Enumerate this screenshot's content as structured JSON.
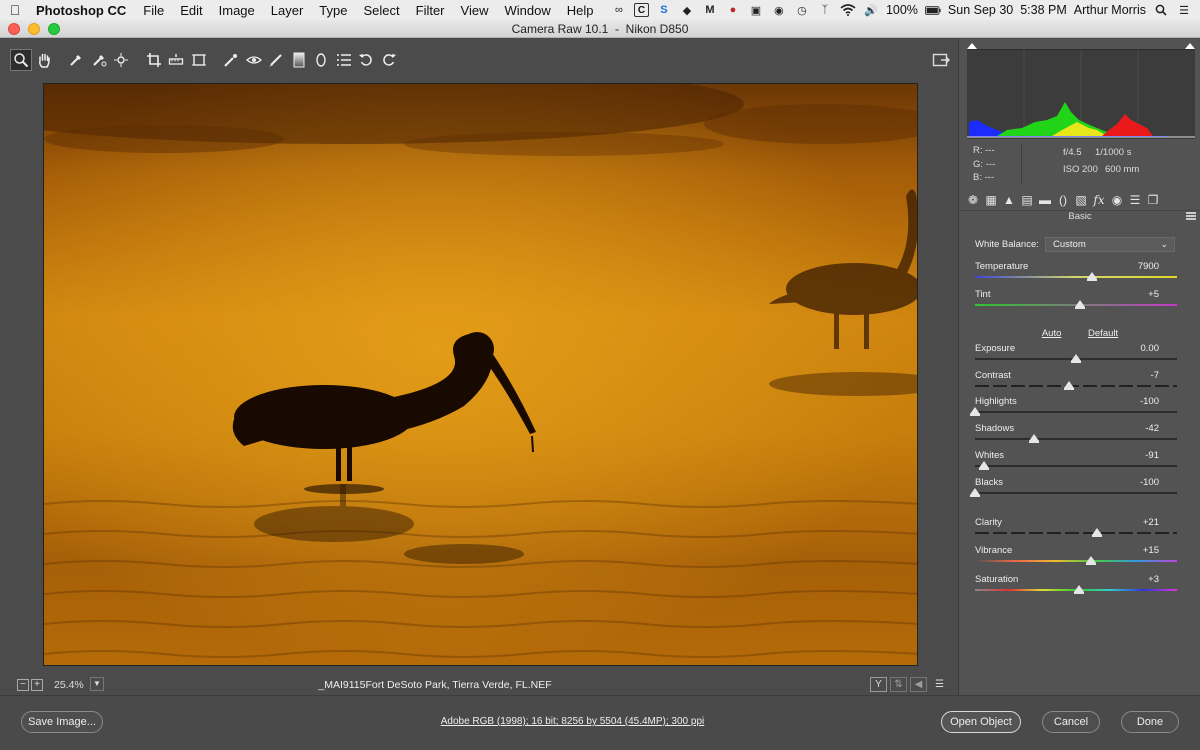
{
  "menubar": {
    "app_name": "Photoshop CC",
    "items": [
      "File",
      "Edit",
      "Image",
      "Layer",
      "Type",
      "Select",
      "Filter",
      "View",
      "Window",
      "Help"
    ],
    "battery": "100%",
    "clock": "Sun Sep 30  5:38 PM",
    "user": "Arthur Morris"
  },
  "window": {
    "title": "Camera Raw 10.1  -  Nikon D850"
  },
  "toolbar": {
    "tools": [
      "zoom-icon",
      "hand-icon",
      "white-balance-icon",
      "color-sampler-icon",
      "target-adjust-icon",
      "crop-icon",
      "straighten-icon",
      "transform-icon",
      "spot-removal-icon",
      "red-eye-icon",
      "adjustment-brush-icon",
      "graduated-filter-icon",
      "radial-filter-icon",
      "preferences-icon",
      "rotate-left-icon",
      "rotate-right-icon"
    ]
  },
  "bottombar": {
    "zoom": "25.4%",
    "filename": "_MAI9115Fort DeSoto Park, Tierra Verde, FL.NEF",
    "before_after_label": "Y"
  },
  "histogram": {
    "r_label": "R:",
    "g_label": "G:",
    "b_label": "B:",
    "r_value": "---",
    "g_value": "---",
    "b_value": "---"
  },
  "exif": {
    "aperture": "f/4.5",
    "shutter": "1/1000 s",
    "iso": "ISO 200",
    "focal": "600 mm"
  },
  "panel": {
    "title": "Basic",
    "white_balance_label": "White Balance:",
    "white_balance_value": "Custom",
    "auto_label": "Auto",
    "default_label": "Default",
    "sliders": [
      {
        "label": "Temperature",
        "value": "7900",
        "pos": 0.58,
        "track": "temp"
      },
      {
        "label": "Tint",
        "value": "+5",
        "pos": 0.52,
        "track": "tint"
      },
      {
        "label": "Exposure",
        "value": "0.00",
        "pos": 0.5,
        "track": "plain"
      },
      {
        "label": "Contrast",
        "value": "-7",
        "pos": 0.465,
        "track": "dashed"
      },
      {
        "label": "Highlights",
        "value": "-100",
        "pos": 0.0,
        "track": "plain"
      },
      {
        "label": "Shadows",
        "value": "-42",
        "pos": 0.29,
        "track": "plain"
      },
      {
        "label": "Whites",
        "value": "-91",
        "pos": 0.045,
        "track": "plain"
      },
      {
        "label": "Blacks",
        "value": "-100",
        "pos": 0.0,
        "track": "plain"
      },
      {
        "label": "Clarity",
        "value": "+21",
        "pos": 0.605,
        "track": "dashed"
      },
      {
        "label": "Vibrance",
        "value": "+15",
        "pos": 0.575,
        "track": "vibrance"
      },
      {
        "label": "Saturation",
        "value": "+3",
        "pos": 0.515,
        "track": "saturation"
      }
    ]
  },
  "footer": {
    "save_label": "Save Image...",
    "workflow": "Adobe RGB (1998); 16 bit; 8256 by 5504 (45.4MP); 300 ppi",
    "open_label": "Open Object",
    "cancel_label": "Cancel",
    "done_label": "Done"
  }
}
